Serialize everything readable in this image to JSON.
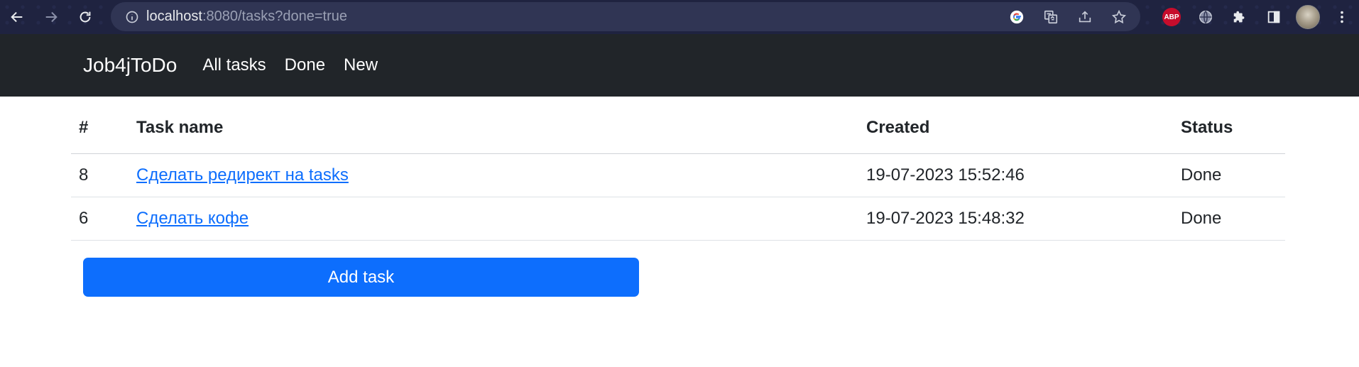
{
  "browser": {
    "url_host": "localhost",
    "url_rest": ":8080/tasks?done=true",
    "icons": [
      "back-icon",
      "forward-icon",
      "reload-icon",
      "info-icon",
      "google-icon",
      "translate-icon",
      "share-icon",
      "star-icon",
      "adblock-icon",
      "globe-icon",
      "extensions-icon",
      "sidepanel-icon",
      "avatar",
      "menu-icon"
    ],
    "abp_label": "ABP"
  },
  "navbar": {
    "brand": "Job4jToDo",
    "links": [
      "All tasks",
      "Done",
      "New"
    ]
  },
  "table": {
    "headers": [
      "#",
      "Task name",
      "Created",
      "Status"
    ],
    "rows": [
      {
        "id": "8",
        "name": "Сделать редирект на tasks",
        "created": "19-07-2023 15:52:46",
        "status": "Done"
      },
      {
        "id": "6",
        "name": "Сделать кофе",
        "created": "19-07-2023 15:48:32",
        "status": "Done"
      }
    ]
  },
  "actions": {
    "add_label": "Add task"
  },
  "colors": {
    "navbar_bg": "#212529",
    "link": "#0d6efd",
    "button": "#0d6efd",
    "chrome_bg": "#1f2340"
  }
}
